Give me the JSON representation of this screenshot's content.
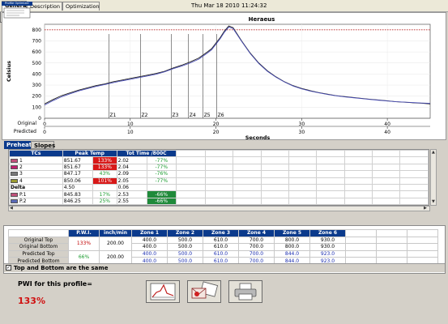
{
  "tabs": [
    {
      "label": "General",
      "active": true
    },
    {
      "label": "Description",
      "active": false
    },
    {
      "label": "Optimization",
      "active": false
    }
  ],
  "datetime": "Thu Mar 18 2010 11:24:32",
  "colors": {
    "original": "#222222",
    "predicted": "#4b4fb8",
    "limit_line": "#c02020",
    "header_blue": "#0b3a8c",
    "alert_red": "#d81818",
    "ok_green": "#1f8a3a"
  },
  "chart_data": {
    "type": "line",
    "title": "Heraeus",
    "ylabel": "Celsius",
    "xlabel": "Seconds",
    "ylim": [
      0,
      850
    ],
    "xlim": [
      0,
      45
    ],
    "yticks": [
      "0",
      "100",
      "200",
      "300",
      "400",
      "500",
      "600",
      "700",
      "800"
    ],
    "top_axis_label": "Original",
    "bottom_axis_label": "Predicted",
    "original_axis_ticks": [
      0,
      10,
      20,
      30,
      40
    ],
    "predicted_axis_ticks": [
      0,
      10,
      20,
      30,
      40
    ],
    "limit_line_y": 800,
    "zone_markers": [
      {
        "label": "Z1",
        "x": 7.5
      },
      {
        "label": "Z2",
        "x": 11.2
      },
      {
        "label": "Z3",
        "x": 14.8
      },
      {
        "label": "Z4",
        "x": 16.8
      },
      {
        "label": "Z5",
        "x": 18.5
      },
      {
        "label": "Z6",
        "x": 20.1
      }
    ],
    "series": [
      {
        "name": "Original",
        "x": [
          0,
          1,
          2,
          3,
          4,
          5,
          6,
          7,
          8,
          9,
          10,
          11,
          12,
          13,
          14,
          15,
          16,
          17,
          18,
          19,
          19.5,
          20,
          20.5,
          21,
          21.5,
          22,
          23,
          24,
          25,
          26,
          27,
          28,
          29,
          30,
          31,
          32,
          33,
          34,
          35,
          36,
          37,
          38,
          39,
          40,
          41,
          42,
          43,
          44,
          45
        ],
        "y": [
          130,
          170,
          205,
          230,
          255,
          275,
          295,
          310,
          330,
          345,
          360,
          375,
          390,
          405,
          425,
          455,
          480,
          510,
          545,
          600,
          630,
          680,
          730,
          790,
          835,
          820,
          700,
          590,
          500,
          430,
          375,
          330,
          295,
          270,
          250,
          232,
          218,
          205,
          196,
          188,
          180,
          172,
          165,
          158,
          150,
          145,
          140,
          136,
          130
        ]
      },
      {
        "name": "Predicted",
        "x": [
          0,
          1,
          2,
          3,
          4,
          5,
          6,
          7,
          8,
          9,
          10,
          11,
          12,
          13,
          14,
          15,
          16,
          17,
          18,
          19,
          19.5,
          20,
          20.5,
          21,
          21.5,
          22,
          23,
          24,
          25,
          26,
          27,
          28,
          29,
          30,
          31,
          32,
          33,
          34,
          35,
          36,
          37,
          38,
          39,
          40,
          41,
          42,
          43,
          44,
          45
        ],
        "y": [
          120,
          160,
          195,
          222,
          248,
          268,
          288,
          305,
          322,
          338,
          352,
          368,
          382,
          398,
          420,
          448,
          472,
          500,
          535,
          590,
          620,
          670,
          720,
          780,
          825,
          812,
          695,
          585,
          495,
          425,
          372,
          328,
          292,
          266,
          246,
          230,
          216,
          204,
          194,
          186,
          178,
          170,
          163,
          156,
          150,
          146,
          142,
          138,
          135
        ]
      }
    ]
  },
  "subtabs": [
    {
      "label": "Preheat",
      "active": true
    },
    {
      "label": "Slopes",
      "active": false
    }
  ],
  "tc_table": {
    "headers": [
      "TCs",
      "Peak Temp",
      "",
      "Tot Time /800C",
      ""
    ],
    "rows": [
      {
        "swatch": "#c0507a",
        "name": "1",
        "peak": "851.67",
        "peak_pct": "133%",
        "peak_pct_style": "red",
        "time": "2.02",
        "time_pct": "-77%",
        "time_pct_style": "green"
      },
      {
        "swatch": "#c02070",
        "name": "2",
        "peak": "851.67",
        "peak_pct": "133%",
        "peak_pct_style": "red",
        "time": "2.04",
        "time_pct": "-77%",
        "time_pct_style": "green"
      },
      {
        "swatch": "#7a7a7a",
        "name": "3",
        "peak": "847.17",
        "peak_pct": "43%",
        "peak_pct_style": "green",
        "time": "2.09",
        "time_pct": "-76%",
        "time_pct_style": "green"
      },
      {
        "swatch": "#9a9a30",
        "name": "4",
        "peak": "850.06",
        "peak_pct": "101%",
        "peak_pct_style": "red",
        "time": "2.05",
        "time_pct": "-77%",
        "time_pct_style": "green"
      },
      {
        "swatch": "",
        "name": "Delta",
        "peak": "4.50",
        "peak_pct": "",
        "peak_pct_style": "",
        "time": "0.06",
        "time_pct": "",
        "time_pct_style": ""
      },
      {
        "swatch": "#c0507a",
        "name": "P.1",
        "peak": "845.83",
        "peak_pct": "17%",
        "peak_pct_style": "green",
        "time": "2.53",
        "time_pct": "-66%",
        "time_pct_style": "greencell"
      },
      {
        "swatch": "#5a6ab8",
        "name": "P.2",
        "peak": "846.25",
        "peak_pct": "25%",
        "peak_pct_style": "green",
        "time": "2.55",
        "time_pct": "-66%",
        "time_pct_style": "greencell"
      }
    ]
  },
  "zone_table": {
    "headers": [
      "",
      "P.W.I.",
      "inch/min",
      "Zone 1",
      "Zone 2",
      "Zone 3",
      "Zone 4",
      "Zone 5",
      "Zone 6"
    ],
    "pwi_original": "133%",
    "speed_original": "200.00",
    "pwi_predicted": "66%",
    "speed_predicted": "200.00",
    "rows": [
      {
        "label": "Original Top",
        "zones": [
          "400.0",
          "500.0",
          "610.0",
          "700.0",
          "800.0",
          "930.0"
        ],
        "kind": "orig"
      },
      {
        "label": "Original Bottom",
        "zones": [
          "400.0",
          "500.0",
          "610.0",
          "700.0",
          "800.0",
          "930.0"
        ],
        "kind": "orig"
      },
      {
        "label": "Predicted Top",
        "zones": [
          "400.0",
          "500.0",
          "610.0",
          "700.0",
          "844.0",
          "923.0"
        ],
        "kind": "pred"
      },
      {
        "label": "Predicted Bottom",
        "zones": [
          "400.0",
          "500.0",
          "610.0",
          "700.0",
          "844.0",
          "923.0"
        ],
        "kind": "pred"
      }
    ]
  },
  "same_checkbox": {
    "label": "Top and Bottom are the same",
    "checked": true
  },
  "pwi": {
    "label": "PWI for this profile=",
    "value": "133%"
  },
  "profile_button": {
    "label": "Profile Optimizer"
  }
}
